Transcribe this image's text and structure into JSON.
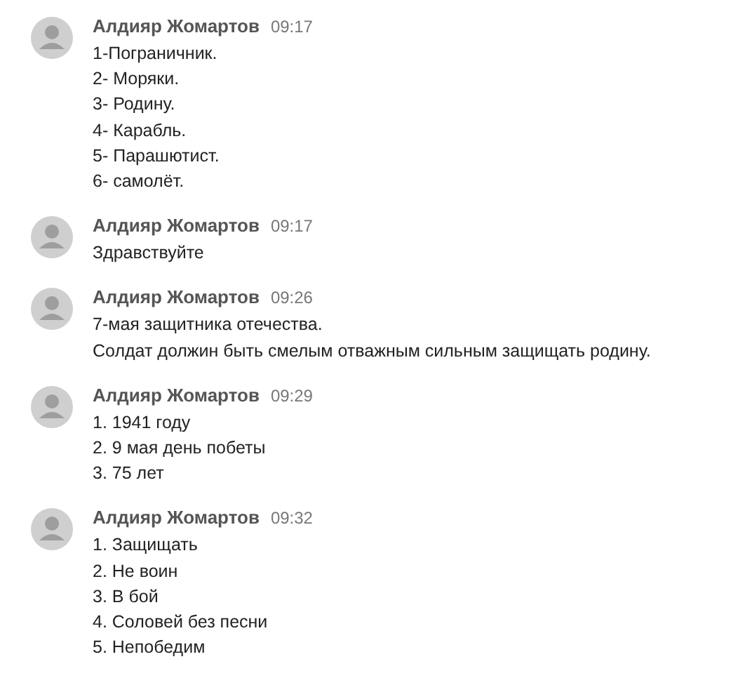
{
  "messages": [
    {
      "author": "Алдияр Жомартов",
      "time": "09:17",
      "lines": [
        "1-Пограничник.",
        "2- Моряки.",
        "3- Родину.",
        "4- Карабль.",
        "5- Парашютист.",
        "6- самолёт."
      ]
    },
    {
      "author": "Алдияр Жомартов",
      "time": "09:17",
      "lines": [
        "Здравствуйте"
      ]
    },
    {
      "author": "Алдияр Жомартов",
      "time": "09:26",
      "lines": [
        "7-мая защитника отечества.",
        "Солдат должин быть смелым отважным сильным защищать родину."
      ]
    },
    {
      "author": "Алдияр Жомартов",
      "time": "09:29",
      "lines": [
        "1. 1941 году",
        "2. 9 мая день побеты",
        "3. 75 лет"
      ]
    },
    {
      "author": "Алдияр Жомартов",
      "time": "09:32",
      "lines": [
        "1. Защищать",
        "2. Не воин",
        "3. В бой",
        "4. Соловей без песни",
        "5. Непобедим"
      ]
    }
  ]
}
